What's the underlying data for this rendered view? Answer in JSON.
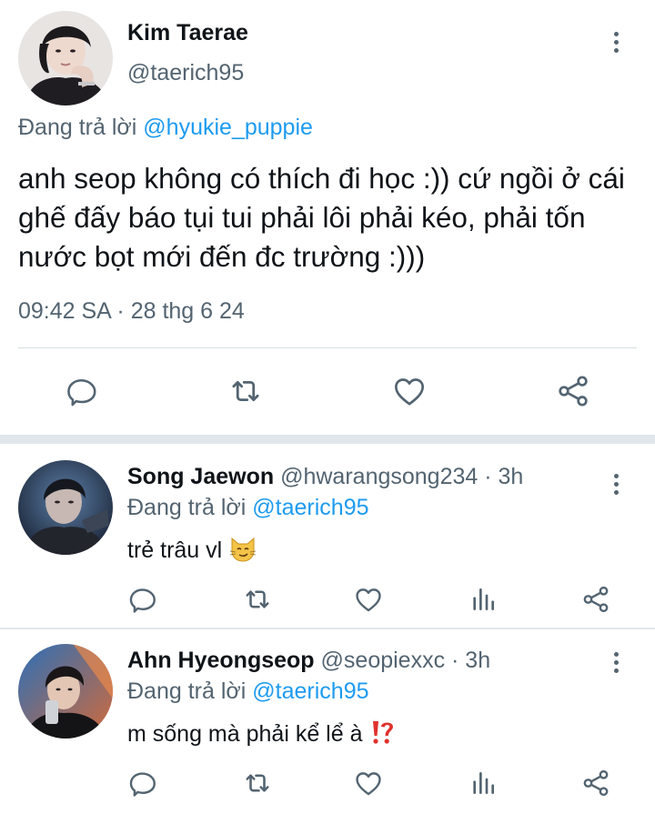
{
  "main_tweet": {
    "author_name": "Kim Taerae",
    "author_handle": "@taerich95",
    "replying_prefix": "Đang trả lời",
    "replying_to": "@hyukie_puppie",
    "text": "anh seop không có thích đi học :)) cứ ngồi ở cái ghế đấy báo tụi tui phải lôi phải kéo, phải tốn nước bọt mới đến đc trường :)))",
    "timestamp": "09:42 SA · 28 thg 6 24",
    "actions": [
      "reply-icon",
      "retweet-icon",
      "like-icon",
      "share-icon"
    ]
  },
  "replies": [
    {
      "author_name": "Song Jaewon",
      "author_handle": "@hwarangsong234",
      "time": " · 3h",
      "replying_prefix": "Đang trả lời",
      "replying_to": "@taerich95",
      "text": "trẻ trâu vl",
      "emoji": "smirking-cat-emoji",
      "actions": [
        "reply-icon",
        "retweet-icon",
        "like-icon",
        "views-icon",
        "share-icon"
      ]
    },
    {
      "author_name": "Ahn Hyeongseop",
      "author_handle": "@seopiexxc",
      "time": " · 3h",
      "replying_prefix": "Đang trả lời",
      "replying_to": "@taerich95",
      "text": "m sống mà phải kể lể à",
      "emoji": "exclamation-question-emoji",
      "actions": [
        "reply-icon",
        "retweet-icon",
        "like-icon",
        "views-icon",
        "share-icon"
      ]
    }
  ],
  "colors": {
    "link": "#1d9bf0",
    "muted": "#536471",
    "text": "#0f1419",
    "divider": "#e1e6ea"
  }
}
